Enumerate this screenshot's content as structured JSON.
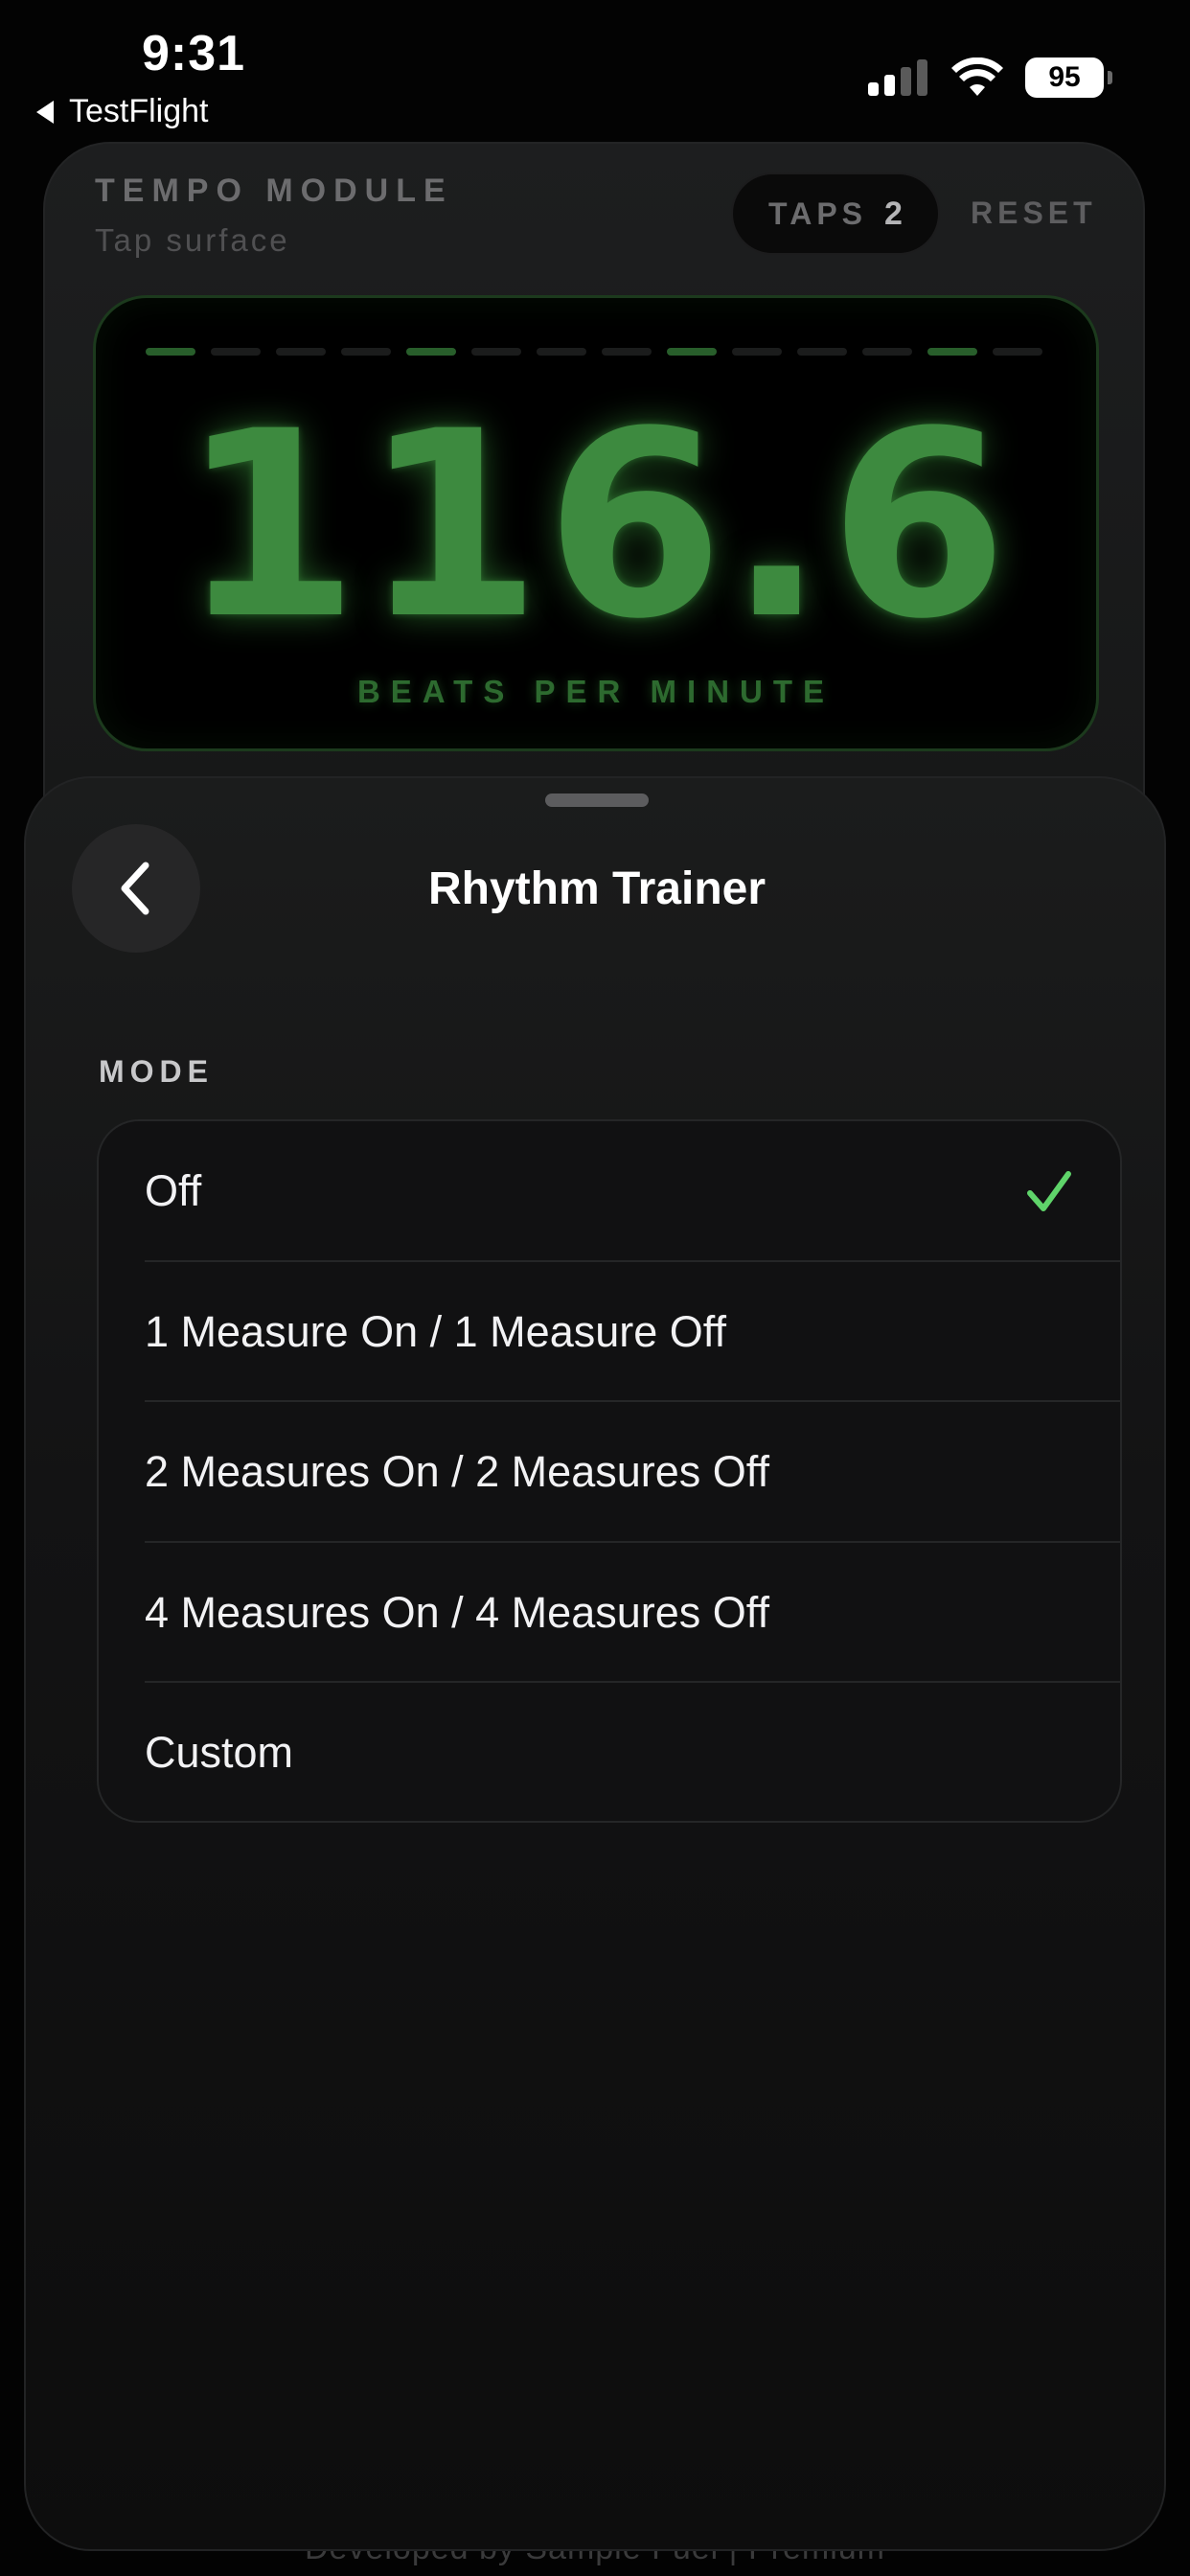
{
  "status_bar": {
    "time": "9:31",
    "back_app": "TestFlight",
    "battery": "95"
  },
  "tempo_module": {
    "title": "TEMPO MODULE",
    "subtitle": "Tap surface",
    "taps_label": "TAPS",
    "taps_count": "2",
    "reset_label": "RESET",
    "bpm": "116.6",
    "bpm_label": "BEATS PER MINUTE",
    "accent_color": "#3d8a3f"
  },
  "footer": {
    "text": "Developed by Sample Fuel  |  Premium"
  },
  "sheet": {
    "title": "Rhythm Trainer",
    "section_label": "MODE",
    "options": [
      {
        "label": "Off",
        "selected": true
      },
      {
        "label": "1 Measure On / 1 Measure Off",
        "selected": false
      },
      {
        "label": "2 Measures On / 2 Measures Off",
        "selected": false
      },
      {
        "label": "4 Measures On / 4 Measures Off",
        "selected": false
      },
      {
        "label": "Custom",
        "selected": false
      }
    ],
    "check_color": "#5fd46a",
    "icons": {
      "back": "chevron-left-icon",
      "selected": "checkmark-icon"
    }
  }
}
